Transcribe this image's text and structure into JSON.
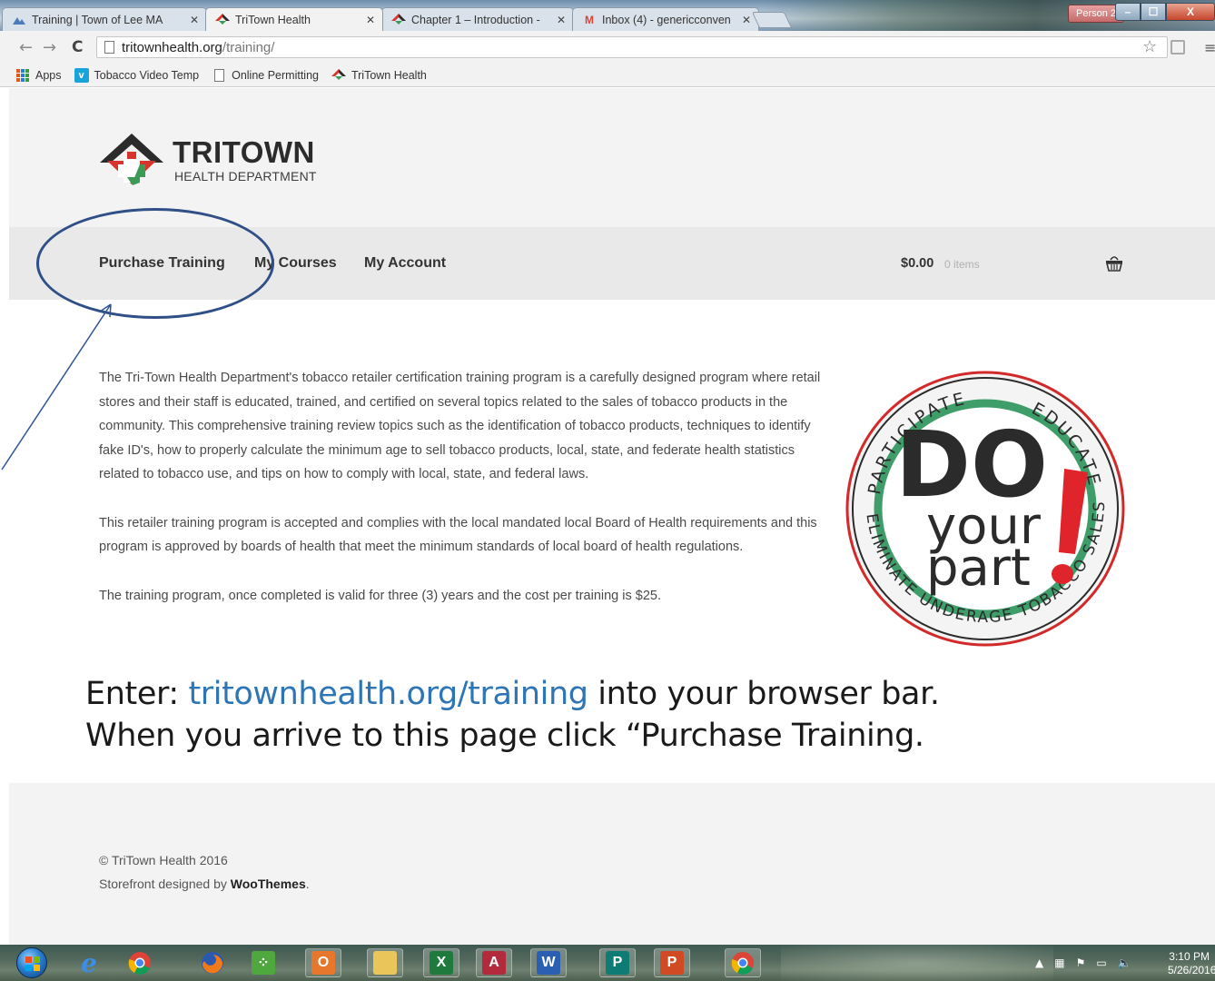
{
  "browser": {
    "tabs": [
      {
        "title": "Training | Town of Lee MA",
        "favicon": "town-favicon"
      },
      {
        "title": "TriTown Health",
        "favicon": "tritown-favicon"
      },
      {
        "title": "Chapter 1 – Introduction -",
        "favicon": "tritown-favicon"
      },
      {
        "title": "Inbox (4) - genericconven",
        "favicon": "gmail-icon"
      }
    ],
    "active_tab": 1,
    "profile_label": "Person 2",
    "window_controls": {
      "minimize": "–",
      "maximize": "☐",
      "close": "X"
    },
    "omnibox": {
      "host": "tritownhealth.org",
      "path": "/training/"
    },
    "bookmarks": [
      {
        "label": "Apps",
        "icon": "apps-grid-icon"
      },
      {
        "label": "Tobacco Video Temp",
        "icon": "vimeo-icon"
      },
      {
        "label": "Online Permitting",
        "icon": "page-icon"
      },
      {
        "label": "TriTown Health",
        "icon": "tritown-favicon"
      }
    ]
  },
  "site": {
    "logo_title": "TRITOWN",
    "logo_subtitle": "HEALTH DEPARTMENT",
    "nav": [
      "Purchase Training",
      "My Courses",
      "My Account"
    ],
    "cart": {
      "amount": "$0.00",
      "items": "0 items"
    },
    "paragraphs": [
      "The Tri-Town Health Department's tobacco retailer certification training program is a carefully designed program where retail stores and their staff is educated, trained, and certified on several topics related to the sales of tobacco products in the community. This comprehensive training review topics such as the identification of tobacco products, techniques to identify fake ID's, how to properly calculate the minimum age to sell tobacco products, local, state, and federate health statistics related to tobacco use, and tips on how to comply with local, state, and federal laws.",
      "This retailer training program is accepted and complies with the local mandated local Board of Health requirements and this program is approved by boards of health that meet the minimum standards of local board of health regulations.",
      "The training program, once completed is valid for three (3) years and the cost per training is $25."
    ],
    "badge": {
      "top_left": "PARTICIPATE",
      "top_right": "EDUCATE",
      "big": "DO",
      "line2": "your",
      "line3": "part",
      "bottom": "ELIMINATE UNDERAGE TOBACCO SALES"
    },
    "footer": {
      "copyright": "© TriTown Health 2016",
      "credit_prefix": "Storefront designed by ",
      "credit_brand": "WooThemes",
      "credit_suffix": "."
    }
  },
  "instruction": {
    "line1_prefix": "Enter: ",
    "line1_link": "tritownhealth.org/training",
    "line1_suffix": " into your browser bar.",
    "line2": "When you arrive to this page click “Purchase Training."
  },
  "taskbar": {
    "apps": [
      "internet-explorer-icon",
      "chrome-icon",
      "firefox-icon",
      "games-icon",
      "outlook-icon",
      "file-explorer-icon",
      "excel-icon",
      "access-icon",
      "word-icon",
      "publisher-icon",
      "powerpoint-icon",
      "chrome-active-icon"
    ],
    "time": "3:10 PM",
    "date": "5/26/2016"
  },
  "colors": {
    "link_blue": "#2e75b6",
    "annotation_blue": "#2f4f86",
    "logo_red": "#d6342c",
    "logo_green": "#3a9b57",
    "badge_green": "#3f9d6a"
  }
}
